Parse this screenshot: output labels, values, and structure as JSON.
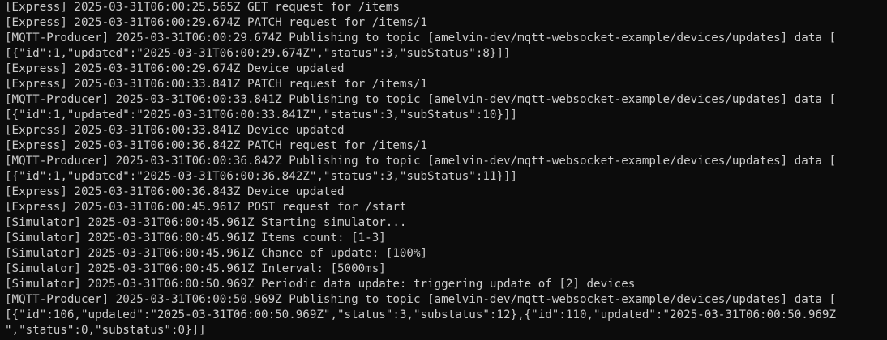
{
  "terminal": {
    "lines": [
      "[Express] 2025-03-31T06:00:25.565Z GET request for /items",
      "[Express] 2025-03-31T06:00:29.674Z PATCH request for /items/1",
      "[MQTT-Producer] 2025-03-31T06:00:29.674Z Publishing to topic [amelvin-dev/mqtt-websocket-example/devices/updates] data [",
      "[{\"id\":1,\"updated\":\"2025-03-31T06:00:29.674Z\",\"status\":3,\"subStatus\":8}]]",
      "[Express] 2025-03-31T06:00:29.674Z Device updated",
      "[Express] 2025-03-31T06:00:33.841Z PATCH request for /items/1",
      "[MQTT-Producer] 2025-03-31T06:00:33.841Z Publishing to topic [amelvin-dev/mqtt-websocket-example/devices/updates] data [",
      "[{\"id\":1,\"updated\":\"2025-03-31T06:00:33.841Z\",\"status\":3,\"subStatus\":10}]]",
      "[Express] 2025-03-31T06:00:33.841Z Device updated",
      "[Express] 2025-03-31T06:00:36.842Z PATCH request for /items/1",
      "[MQTT-Producer] 2025-03-31T06:00:36.842Z Publishing to topic [amelvin-dev/mqtt-websocket-example/devices/updates] data [",
      "[{\"id\":1,\"updated\":\"2025-03-31T06:00:36.842Z\",\"status\":3,\"subStatus\":11}]]",
      "[Express] 2025-03-31T06:00:36.843Z Device updated",
      "[Express] 2025-03-31T06:00:45.961Z POST request for /start",
      "[Simulator] 2025-03-31T06:00:45.961Z Starting simulator...",
      "[Simulator] 2025-03-31T06:00:45.961Z Items count: [1-3]",
      "[Simulator] 2025-03-31T06:00:45.961Z Chance of update: [100%]",
      "[Simulator] 2025-03-31T06:00:45.961Z Interval: [5000ms]",
      "[Simulator] 2025-03-31T06:00:50.969Z Periodic data update: triggering update of [2] devices",
      "[MQTT-Producer] 2025-03-31T06:00:50.969Z Publishing to topic [amelvin-dev/mqtt-websocket-example/devices/updates] data [",
      "[{\"id\":106,\"updated\":\"2025-03-31T06:00:50.969Z\",\"status\":3,\"substatus\":12},{\"id\":110,\"updated\":\"2025-03-31T06:00:50.969Z",
      "\",\"status\":0,\"substatus\":0}]]"
    ]
  },
  "colors": {
    "background": "#0c0c0c",
    "foreground": "#cccccc"
  }
}
